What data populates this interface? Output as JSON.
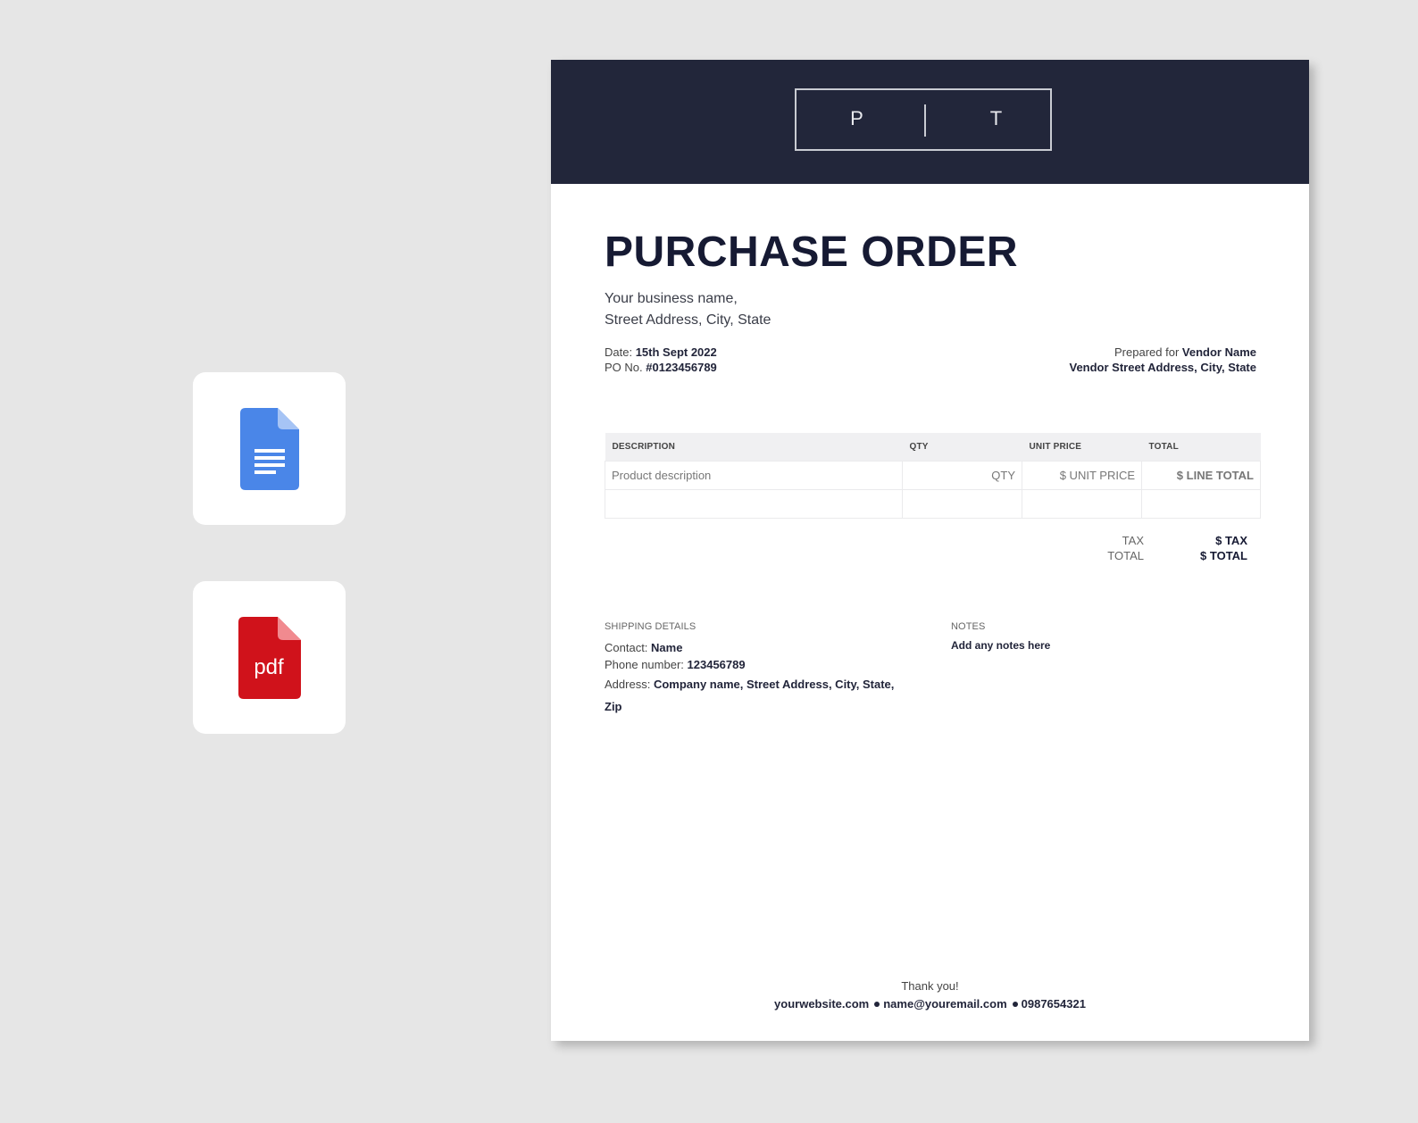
{
  "document": {
    "logo_left": "P",
    "logo_right": "T",
    "title": "PURCHASE ORDER",
    "business_name": "Your business name,",
    "business_address": "Street Address, City, State",
    "date_label": "Date:",
    "date_value": "15th Sept 2022",
    "po_label": "PO No.",
    "po_value": "#0123456789",
    "prepared_label": "Prepared for",
    "vendor_name": "Vendor Name",
    "vendor_address": "Vendor Street Address, City, State"
  },
  "table": {
    "headers": [
      "DESCRIPTION",
      "QTY",
      "UNIT PRICE",
      "TOTAL"
    ],
    "rows": [
      [
        "Product description",
        "QTY",
        "$ UNIT PRICE",
        "$ LINE TOTAL"
      ],
      [
        "",
        "",
        "",
        ""
      ]
    ]
  },
  "totals": {
    "tax_label": "TAX",
    "tax_value": "$ TAX",
    "total_label": "TOTAL",
    "total_value": "$ TOTAL"
  },
  "shipping": {
    "heading": "SHIPPING DETAILS",
    "contact_label": "Contact:",
    "contact_value": "Name",
    "phone_label": "Phone number:",
    "phone_value": "123456789",
    "address_label": "Address:",
    "address_value": "Company name, Street Address, City, State, Zip"
  },
  "notes": {
    "heading": "NOTES",
    "text": "Add any notes here"
  },
  "footer": {
    "thanks": "Thank you!",
    "website": "yourwebsite.com",
    "email": "name@youremail.com",
    "phone": "0987654321"
  },
  "icons": {
    "gdoc": {
      "name": "google-docs-icon",
      "color": "#4a86e8"
    },
    "pdf": {
      "name": "pdf-icon",
      "color": "#d0121b",
      "label": "pdf"
    }
  }
}
